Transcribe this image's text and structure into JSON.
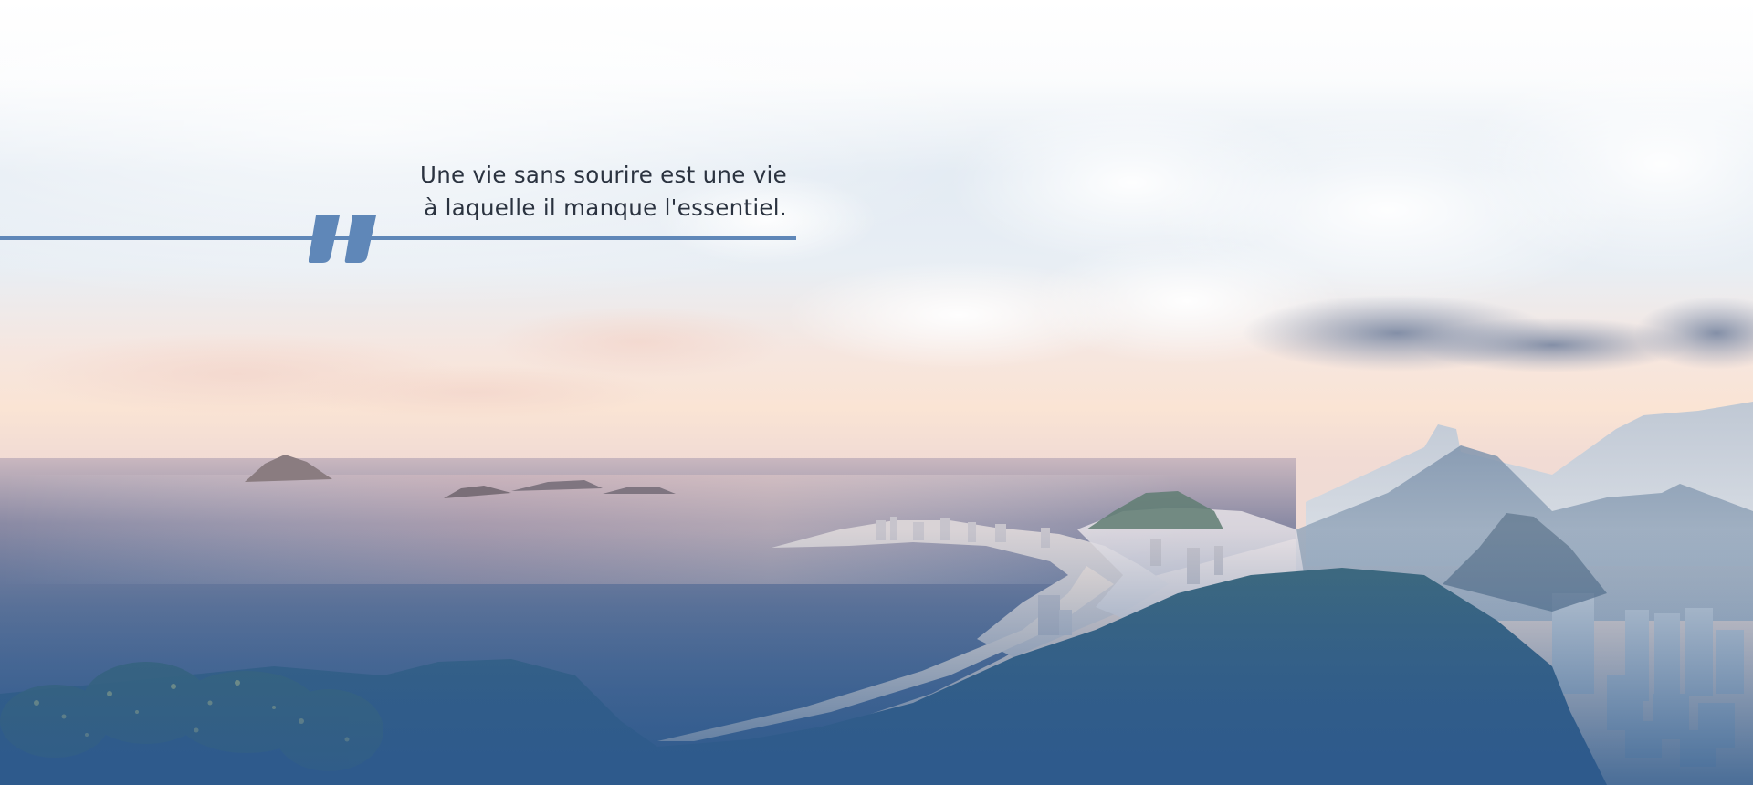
{
  "quote": {
    "line1": "Une vie sans sourire est une vie",
    "line2": "à laquelle il manque l'essentiel."
  },
  "icons": {
    "quote_mark": "closing-quotation-mark-icon"
  },
  "colors": {
    "accent": "#5f87b8",
    "text": "#2b3340",
    "sea_deep": "#2e5a8c"
  }
}
